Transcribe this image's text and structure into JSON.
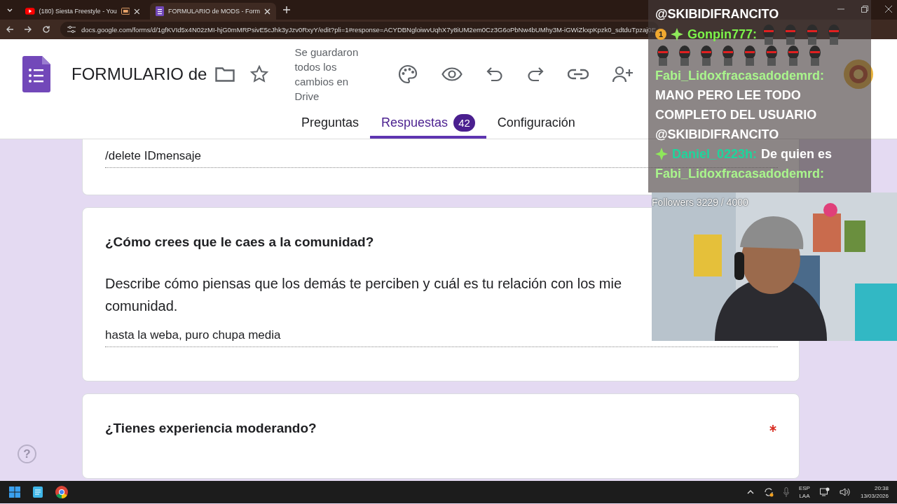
{
  "browser": {
    "tabs": [
      {
        "title": "(180) Siesta Freestyle - You",
        "kind": "video",
        "selected": false
      },
      {
        "title": "FORMULARIO de MODS - Form",
        "kind": "form",
        "selected": true
      }
    ],
    "url": "docs.google.com/forms/d/1gfKVId5x4N02zMI-hjG0mMRPsivE5cJhk3yJzv0RxyY/edit?pli=1#response=ACYDBNgloiwvUqhX7y8iUM2em0Cz3G6oPbNw4bUMhy3M-iGWiZkxpKpzk0_sdtduTpzaj0E"
  },
  "form_header": {
    "title": "FORMULARIO de",
    "save_status": "Se guardaron todos los cambios en Drive",
    "tabs": [
      {
        "label": "Preguntas",
        "selected": false
      },
      {
        "label": "Respuestas",
        "selected": true,
        "count": "42"
      },
      {
        "label": "Configuración",
        "selected": false
      }
    ]
  },
  "cards": [
    {
      "kind": "answer_only",
      "answer": "/delete IDmensaje"
    },
    {
      "kind": "question",
      "title": "¿Cómo crees que le caes a la comunidad?",
      "description_lines": [
        "Describe cómo piensas que los demás te perciben y cuál es tu relación con los mie",
        "comunidad."
      ],
      "answer": "hasta la weba, puro chupa media",
      "required": false
    },
    {
      "kind": "question",
      "title": "¿Tienes experiencia moderando?",
      "required": true
    }
  ],
  "help_button": "?",
  "stream_overlay": {
    "channel": "@SKIBIDIFRANCITO",
    "messages": [
      {
        "badge": "1",
        "diamond": true,
        "user": "Gonpin777:",
        "color": "#7cf34a",
        "emotes": [
          {
            "kind": "emote"
          },
          {
            "kind": "emote"
          },
          {
            "kind": "emote"
          },
          {
            "kind": "emote"
          },
          {
            "kind": "emote"
          },
          {
            "kind": "emote"
          },
          {
            "kind": "emote"
          },
          {
            "kind": "emote"
          },
          {
            "kind": "emote"
          },
          {
            "kind": "emote"
          },
          {
            "kind": "emote"
          },
          {
            "kind": "emote"
          }
        ]
      },
      {
        "diamond": false,
        "user": "Fabi_Lidoxfracasadodemrd:",
        "color": "#a9f58c",
        "text": "MANO PERO LEE TODO COMPLETO DEL USUARIO @SKIBIDIFRANCITO"
      },
      {
        "diamond": true,
        "user": "Daniel_0223h:",
        "color": "#1ed69c",
        "text": "De quien es"
      },
      {
        "diamond": false,
        "user": "Fabi_Lidoxfracasadodemrd:",
        "color": "#a9f58c"
      }
    ],
    "followers": "Followers 3229 / 4000"
  },
  "taskbar": {
    "language": "ESP",
    "layout": "LAA",
    "time": "20:38",
    "date": "13/03/2026"
  }
}
